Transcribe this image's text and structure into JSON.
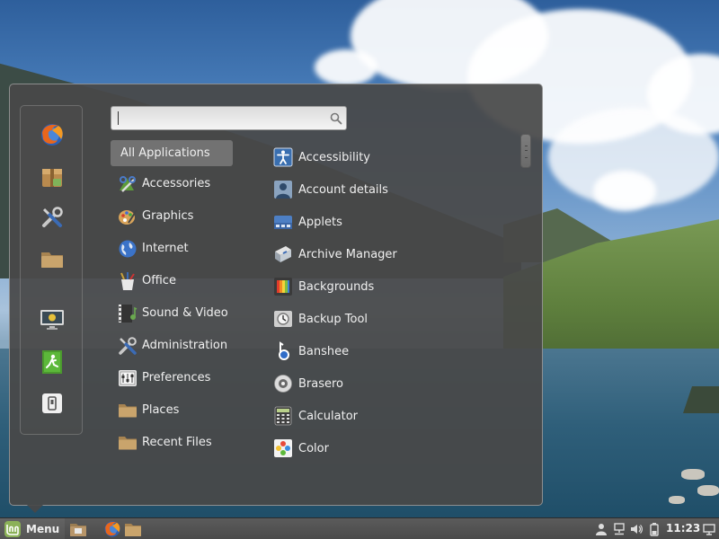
{
  "search": {
    "value": "",
    "placeholder": ""
  },
  "favorites": [
    {
      "name": "Firefox Web Browser",
      "icon": "firefox-icon"
    },
    {
      "name": "Software Manager",
      "icon": "package-icon"
    },
    {
      "name": "System Settings",
      "icon": "tools-icon"
    },
    {
      "name": "Files",
      "icon": "folder-icon"
    },
    {
      "name": "Lock Screen",
      "icon": "lock-screen-icon"
    },
    {
      "name": "Logout",
      "icon": "logout-icon"
    },
    {
      "name": "Quit",
      "icon": "shutdown-icon"
    }
  ],
  "categories": [
    {
      "label": "All Applications",
      "selected": true
    },
    {
      "label": "Accessories",
      "icon": "accessories-icon"
    },
    {
      "label": "Graphics",
      "icon": "graphics-icon"
    },
    {
      "label": "Internet",
      "icon": "internet-icon"
    },
    {
      "label": "Office",
      "icon": "office-icon"
    },
    {
      "label": "Sound & Video",
      "icon": "sound-video-icon"
    },
    {
      "label": "Administration",
      "icon": "administration-icon"
    },
    {
      "label": "Preferences",
      "icon": "preferences-icon"
    },
    {
      "label": "Places",
      "icon": "folder-icon"
    },
    {
      "label": "Recent Files",
      "icon": "folder-icon"
    }
  ],
  "apps": [
    {
      "label": "Accessibility",
      "icon": "accessibility-icon"
    },
    {
      "label": "Account details",
      "icon": "account-icon"
    },
    {
      "label": "Applets",
      "icon": "applets-icon"
    },
    {
      "label": "Archive Manager",
      "icon": "archive-icon"
    },
    {
      "label": "Backgrounds",
      "icon": "backgrounds-icon"
    },
    {
      "label": "Backup Tool",
      "icon": "backup-icon"
    },
    {
      "label": "Banshee",
      "icon": "banshee-icon"
    },
    {
      "label": "Brasero",
      "icon": "brasero-icon"
    },
    {
      "label": "Calculator",
      "icon": "calculator-icon"
    },
    {
      "label": "Color",
      "icon": "color-icon"
    }
  ],
  "panel": {
    "menu_label": "Menu",
    "clock": "11:23",
    "launchers": [
      "show-desktop-icon",
      "firefox-icon",
      "folder-icon"
    ],
    "tray": [
      "user-icon",
      "network-icon",
      "volume-icon",
      "battery-icon",
      "display-icon"
    ]
  },
  "colors": {
    "menu_bg": "#484848",
    "selected_bg": "#8a8a8a",
    "panel_bg": "#4f4f4f",
    "mint_green": "#8bb158"
  }
}
